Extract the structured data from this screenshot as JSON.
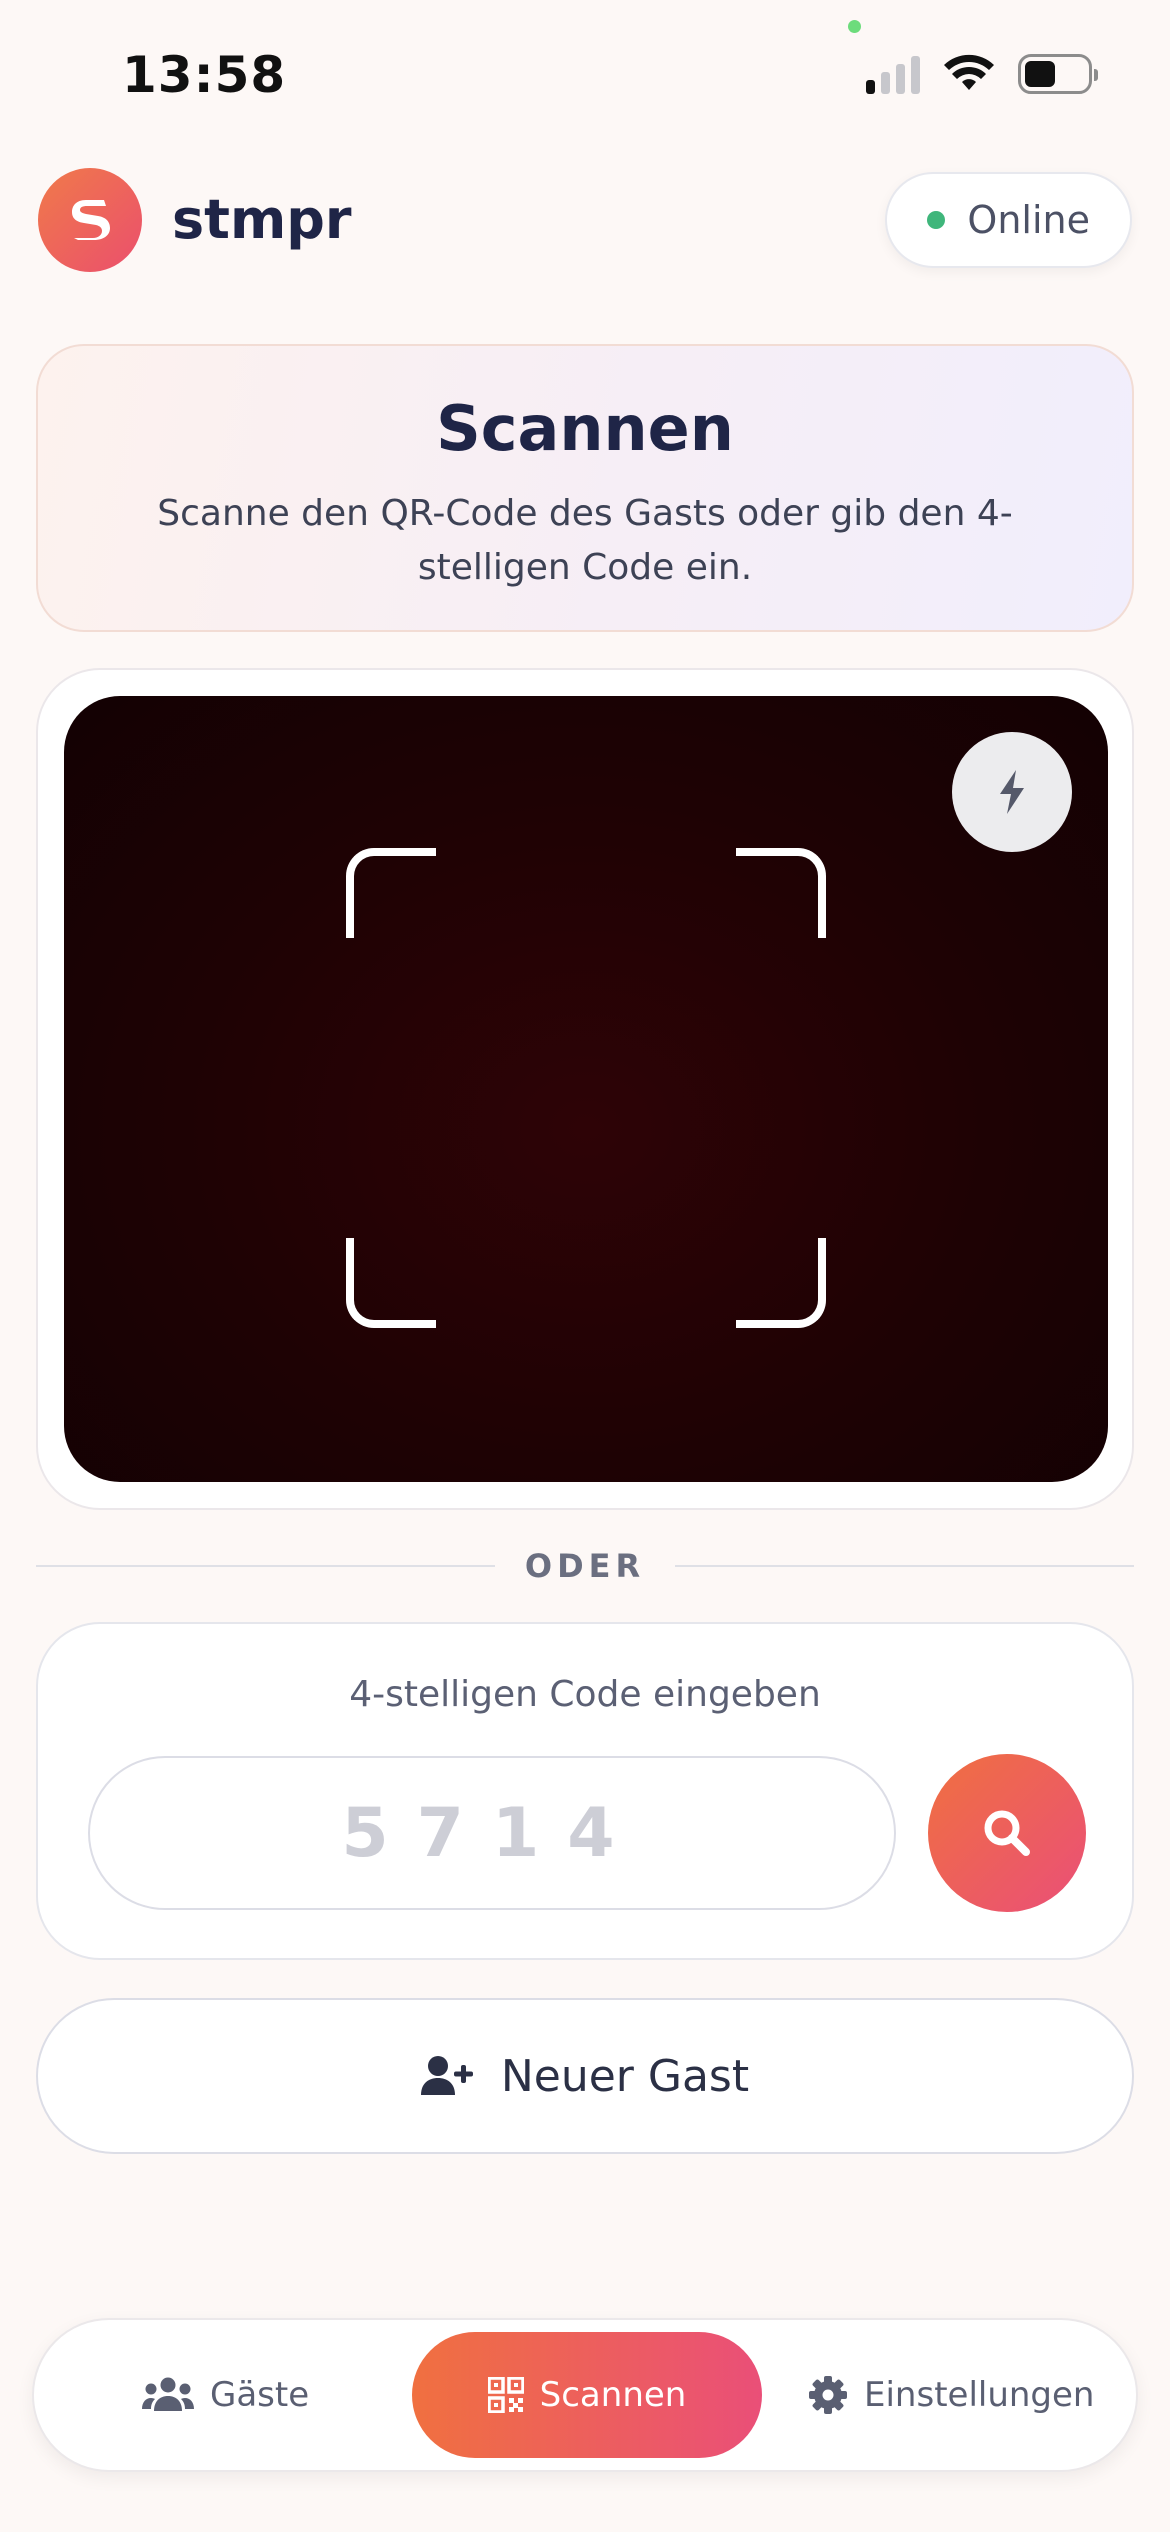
{
  "status_bar": {
    "time": "13:58"
  },
  "header": {
    "brand": "stmpr",
    "status": "Online"
  },
  "title_card": {
    "title": "Scannen",
    "subtitle": "Scanne den QR-Code des Gasts oder gib den 4-stelligen Code ein."
  },
  "camera": {
    "flash_icon": "flash-icon"
  },
  "divider": {
    "label": "ODER"
  },
  "code_entry": {
    "label": "4-stelligen Code eingeben",
    "placeholder": "5714",
    "value": ""
  },
  "new_guest": {
    "label": "Neuer Gast"
  },
  "bottom_nav": {
    "items": [
      {
        "label": "Gäste",
        "icon": "users-icon",
        "active": false
      },
      {
        "label": "Scannen",
        "icon": "qr-code-icon",
        "active": true
      },
      {
        "label": "Einstellungen",
        "icon": "gear-icon",
        "active": false
      }
    ]
  },
  "colors": {
    "accent_start": "#f07040",
    "accent_end": "#ea4f78",
    "online": "#3fb67b",
    "camera_bg": "#1e0204",
    "text_dark": "#1f2547"
  }
}
